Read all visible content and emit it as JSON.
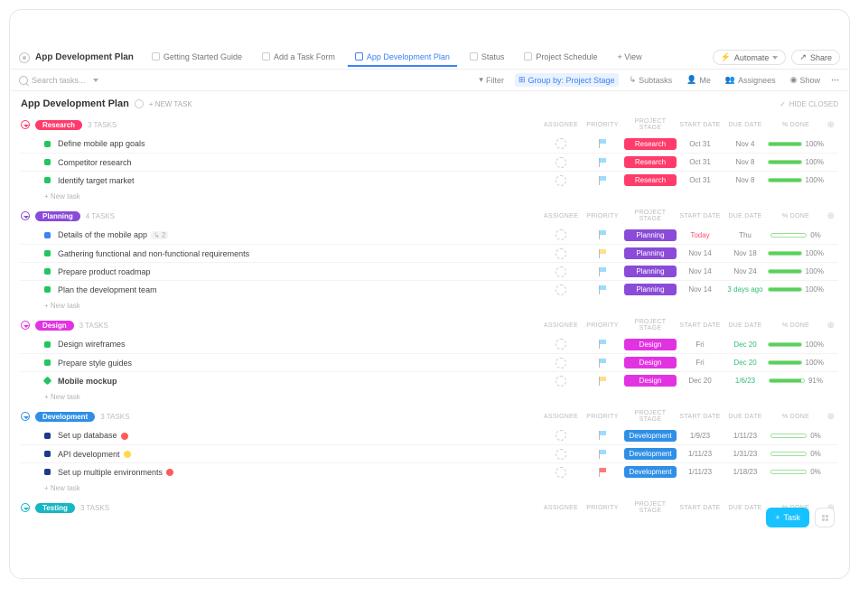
{
  "header": {
    "title": "App Development Plan",
    "tabs": [
      {
        "label": "Getting Started Guide"
      },
      {
        "label": "Add a Task Form"
      },
      {
        "label": "App Development Plan",
        "active": true
      },
      {
        "label": "Status"
      },
      {
        "label": "Project Schedule"
      }
    ],
    "add_view": "+ View",
    "automate": "Automate",
    "share": "Share"
  },
  "toolbar": {
    "search_placeholder": "Search tasks...",
    "filter": "Filter",
    "group_by": "Group by: Project Stage",
    "subtasks": "Subtasks",
    "me": "Me",
    "assignees": "Assignees",
    "show": "Show"
  },
  "list": {
    "title": "App Development Plan",
    "new_task_label": "+ NEW TASK",
    "hide_closed": "HIDE CLOSED",
    "columns": {
      "assignee": "ASSIGNEE",
      "priority": "PRIORITY",
      "stage": "PROJECT STAGE",
      "start": "START DATE",
      "due": "DUE DATE",
      "done": "% DONE",
      "plus": "⊕"
    },
    "new_row": "+ New task"
  },
  "colors": {
    "research": "#ff3b6b",
    "planning": "#8a4bd8",
    "design": "#e233e2",
    "development": "#2f8fe6",
    "testing": "#15b7c4"
  },
  "groups": [
    {
      "key": "research",
      "label": "Research",
      "count": "3 TASKS",
      "ring": "#ff3b6b",
      "tasks": [
        {
          "sq": "green",
          "name": "Define mobile app goals",
          "flag": "cyan",
          "stage": "Research",
          "start": "Oct 31",
          "due": "Nov 4",
          "pct": 100
        },
        {
          "sq": "green",
          "name": "Competitor research",
          "flag": "cyan",
          "stage": "Research",
          "start": "Oct 31",
          "due": "Nov 8",
          "pct": 100
        },
        {
          "sq": "green",
          "name": "Identify target market",
          "flag": "cyan",
          "stage": "Research",
          "start": "Oct 31",
          "due": "Nov 8",
          "pct": 100
        }
      ]
    },
    {
      "key": "planning",
      "label": "Planning",
      "count": "4 TASKS",
      "ring": "#8a4bd8",
      "tasks": [
        {
          "sq": "blue",
          "name": "Details of the mobile app",
          "sub": "2",
          "flag": "cyan",
          "stage": "Planning",
          "start": "Today",
          "start_cls": "today",
          "due": "Thu",
          "pct": 0
        },
        {
          "sq": "green",
          "name": "Gathering functional and non-functional requirements",
          "flag": "yellow",
          "stage": "Planning",
          "start": "Nov 14",
          "due": "Nov 18",
          "pct": 100
        },
        {
          "sq": "green",
          "name": "Prepare product roadmap",
          "flag": "cyan",
          "stage": "Planning",
          "start": "Nov 14",
          "due": "Nov 24",
          "pct": 100
        },
        {
          "sq": "green",
          "name": "Plan the development team",
          "flag": "cyan",
          "stage": "Planning",
          "start": "Nov 14",
          "due": "3 days ago",
          "due_cls": "green",
          "pct": 100
        }
      ]
    },
    {
      "key": "design",
      "label": "Design",
      "count": "3 TASKS",
      "ring": "#e233e2",
      "tasks": [
        {
          "sq": "green",
          "name": "Design wireframes",
          "flag": "cyan",
          "stage": "Design",
          "start": "Fri",
          "due": "Dec 20",
          "due_cls": "green",
          "pct": 100
        },
        {
          "sq": "green",
          "name": "Prepare style guides",
          "flag": "cyan",
          "stage": "Design",
          "start": "Fri",
          "due": "Dec 20",
          "due_cls": "green",
          "pct": 100
        },
        {
          "sq": "diamond",
          "bold": true,
          "name": "Mobile mockup",
          "flag": "yellow",
          "stage": "Design",
          "start": "Dec 20",
          "due": "1/6/23",
          "due_cls": "green",
          "pct": 91
        }
      ]
    },
    {
      "key": "development",
      "label": "Development",
      "count": "3 TASKS",
      "ring": "#2f8fe6",
      "tasks": [
        {
          "sq": "navy",
          "name": "Set up database",
          "badge": "red",
          "flag": "cyan",
          "stage": "Development",
          "start": "1/9/23",
          "due": "1/11/23",
          "pct": 0
        },
        {
          "sq": "navy",
          "name": "API development",
          "badge": "yellow",
          "flag": "cyan",
          "stage": "Development",
          "start": "1/11/23",
          "due": "1/31/23",
          "pct": 0
        },
        {
          "sq": "navy",
          "name": "Set up multiple environments",
          "badge": "red",
          "flag": "red",
          "stage": "Development",
          "start": "1/11/23",
          "due": "1/18/23",
          "pct": 0
        }
      ]
    },
    {
      "key": "testing",
      "label": "Testing",
      "count": "3 TASKS",
      "ring": "#15b7c4",
      "tasks": []
    }
  ],
  "fab": {
    "task": "Task"
  }
}
